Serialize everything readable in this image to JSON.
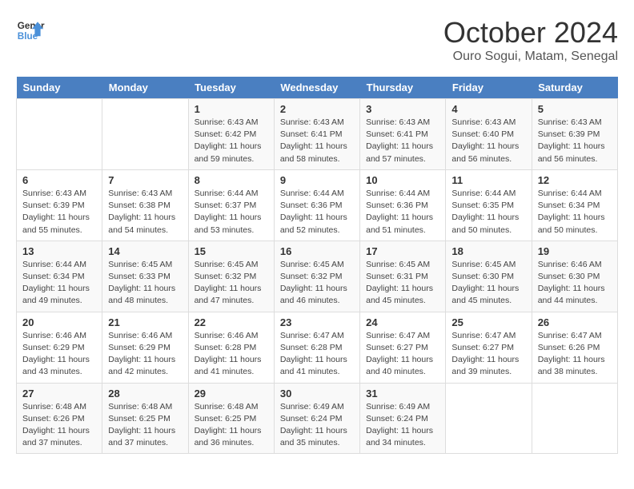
{
  "header": {
    "logo_line1": "General",
    "logo_line2": "Blue",
    "month": "October 2024",
    "location": "Ouro Sogui, Matam, Senegal"
  },
  "weekdays": [
    "Sunday",
    "Monday",
    "Tuesday",
    "Wednesday",
    "Thursday",
    "Friday",
    "Saturday"
  ],
  "weeks": [
    [
      {
        "day": "",
        "info": ""
      },
      {
        "day": "",
        "info": ""
      },
      {
        "day": "1",
        "info": "Sunrise: 6:43 AM\nSunset: 6:42 PM\nDaylight: 11 hours and 59 minutes."
      },
      {
        "day": "2",
        "info": "Sunrise: 6:43 AM\nSunset: 6:41 PM\nDaylight: 11 hours and 58 minutes."
      },
      {
        "day": "3",
        "info": "Sunrise: 6:43 AM\nSunset: 6:41 PM\nDaylight: 11 hours and 57 minutes."
      },
      {
        "day": "4",
        "info": "Sunrise: 6:43 AM\nSunset: 6:40 PM\nDaylight: 11 hours and 56 minutes."
      },
      {
        "day": "5",
        "info": "Sunrise: 6:43 AM\nSunset: 6:39 PM\nDaylight: 11 hours and 56 minutes."
      }
    ],
    [
      {
        "day": "6",
        "info": "Sunrise: 6:43 AM\nSunset: 6:39 PM\nDaylight: 11 hours and 55 minutes."
      },
      {
        "day": "7",
        "info": "Sunrise: 6:43 AM\nSunset: 6:38 PM\nDaylight: 11 hours and 54 minutes."
      },
      {
        "day": "8",
        "info": "Sunrise: 6:44 AM\nSunset: 6:37 PM\nDaylight: 11 hours and 53 minutes."
      },
      {
        "day": "9",
        "info": "Sunrise: 6:44 AM\nSunset: 6:36 PM\nDaylight: 11 hours and 52 minutes."
      },
      {
        "day": "10",
        "info": "Sunrise: 6:44 AM\nSunset: 6:36 PM\nDaylight: 11 hours and 51 minutes."
      },
      {
        "day": "11",
        "info": "Sunrise: 6:44 AM\nSunset: 6:35 PM\nDaylight: 11 hours and 50 minutes."
      },
      {
        "day": "12",
        "info": "Sunrise: 6:44 AM\nSunset: 6:34 PM\nDaylight: 11 hours and 50 minutes."
      }
    ],
    [
      {
        "day": "13",
        "info": "Sunrise: 6:44 AM\nSunset: 6:34 PM\nDaylight: 11 hours and 49 minutes."
      },
      {
        "day": "14",
        "info": "Sunrise: 6:45 AM\nSunset: 6:33 PM\nDaylight: 11 hours and 48 minutes."
      },
      {
        "day": "15",
        "info": "Sunrise: 6:45 AM\nSunset: 6:32 PM\nDaylight: 11 hours and 47 minutes."
      },
      {
        "day": "16",
        "info": "Sunrise: 6:45 AM\nSunset: 6:32 PM\nDaylight: 11 hours and 46 minutes."
      },
      {
        "day": "17",
        "info": "Sunrise: 6:45 AM\nSunset: 6:31 PM\nDaylight: 11 hours and 45 minutes."
      },
      {
        "day": "18",
        "info": "Sunrise: 6:45 AM\nSunset: 6:30 PM\nDaylight: 11 hours and 45 minutes."
      },
      {
        "day": "19",
        "info": "Sunrise: 6:46 AM\nSunset: 6:30 PM\nDaylight: 11 hours and 44 minutes."
      }
    ],
    [
      {
        "day": "20",
        "info": "Sunrise: 6:46 AM\nSunset: 6:29 PM\nDaylight: 11 hours and 43 minutes."
      },
      {
        "day": "21",
        "info": "Sunrise: 6:46 AM\nSunset: 6:29 PM\nDaylight: 11 hours and 42 minutes."
      },
      {
        "day": "22",
        "info": "Sunrise: 6:46 AM\nSunset: 6:28 PM\nDaylight: 11 hours and 41 minutes."
      },
      {
        "day": "23",
        "info": "Sunrise: 6:47 AM\nSunset: 6:28 PM\nDaylight: 11 hours and 41 minutes."
      },
      {
        "day": "24",
        "info": "Sunrise: 6:47 AM\nSunset: 6:27 PM\nDaylight: 11 hours and 40 minutes."
      },
      {
        "day": "25",
        "info": "Sunrise: 6:47 AM\nSunset: 6:27 PM\nDaylight: 11 hours and 39 minutes."
      },
      {
        "day": "26",
        "info": "Sunrise: 6:47 AM\nSunset: 6:26 PM\nDaylight: 11 hours and 38 minutes."
      }
    ],
    [
      {
        "day": "27",
        "info": "Sunrise: 6:48 AM\nSunset: 6:26 PM\nDaylight: 11 hours and 37 minutes."
      },
      {
        "day": "28",
        "info": "Sunrise: 6:48 AM\nSunset: 6:25 PM\nDaylight: 11 hours and 37 minutes."
      },
      {
        "day": "29",
        "info": "Sunrise: 6:48 AM\nSunset: 6:25 PM\nDaylight: 11 hours and 36 minutes."
      },
      {
        "day": "30",
        "info": "Sunrise: 6:49 AM\nSunset: 6:24 PM\nDaylight: 11 hours and 35 minutes."
      },
      {
        "day": "31",
        "info": "Sunrise: 6:49 AM\nSunset: 6:24 PM\nDaylight: 11 hours and 34 minutes."
      },
      {
        "day": "",
        "info": ""
      },
      {
        "day": "",
        "info": ""
      }
    ]
  ]
}
